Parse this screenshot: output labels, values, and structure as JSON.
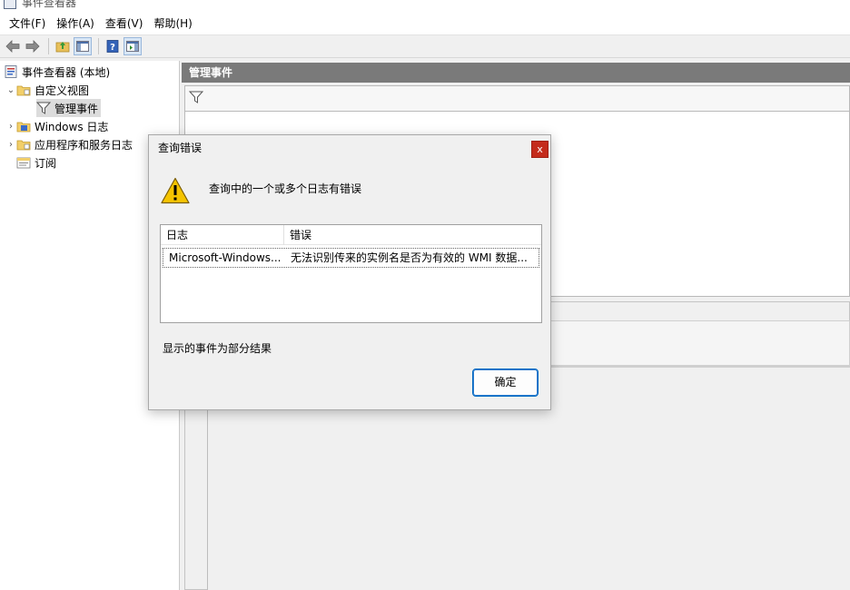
{
  "window": {
    "title": "事件查看器"
  },
  "menu": {
    "items": [
      "文件(F)",
      "操作(A)",
      "查看(V)",
      "帮助(H)"
    ]
  },
  "toolbar": {
    "icons": [
      "back-arrow-icon",
      "forward-arrow-icon",
      "folder-up-icon",
      "show-hide-tree-icon",
      "help-icon",
      "action-pane-icon"
    ]
  },
  "tree": {
    "root": "事件查看器 (本地)",
    "custom_views": "自定义视图",
    "admin_events": "管理事件",
    "windows_logs": "Windows 日志",
    "apps_services": "应用程序和服务日志",
    "subscriptions": "订阅"
  },
  "main": {
    "header": "管理事件"
  },
  "dialog": {
    "title": "查询错误",
    "close": "x",
    "message": "查询中的一个或多个日志有错误",
    "table": {
      "headers": [
        "日志",
        "错误"
      ],
      "rows": [
        [
          "Microsoft-Windows...",
          "无法识别传来的实例名是否为有效的 WMI 数据..."
        ]
      ]
    },
    "note": "显示的事件为部分结果",
    "ok_label": "确定"
  },
  "colors": {
    "header_bg": "#7a7a7a",
    "close_bg": "#c42b1c",
    "ok_border": "#0067c0",
    "warning_yellow": "#f5c400"
  }
}
